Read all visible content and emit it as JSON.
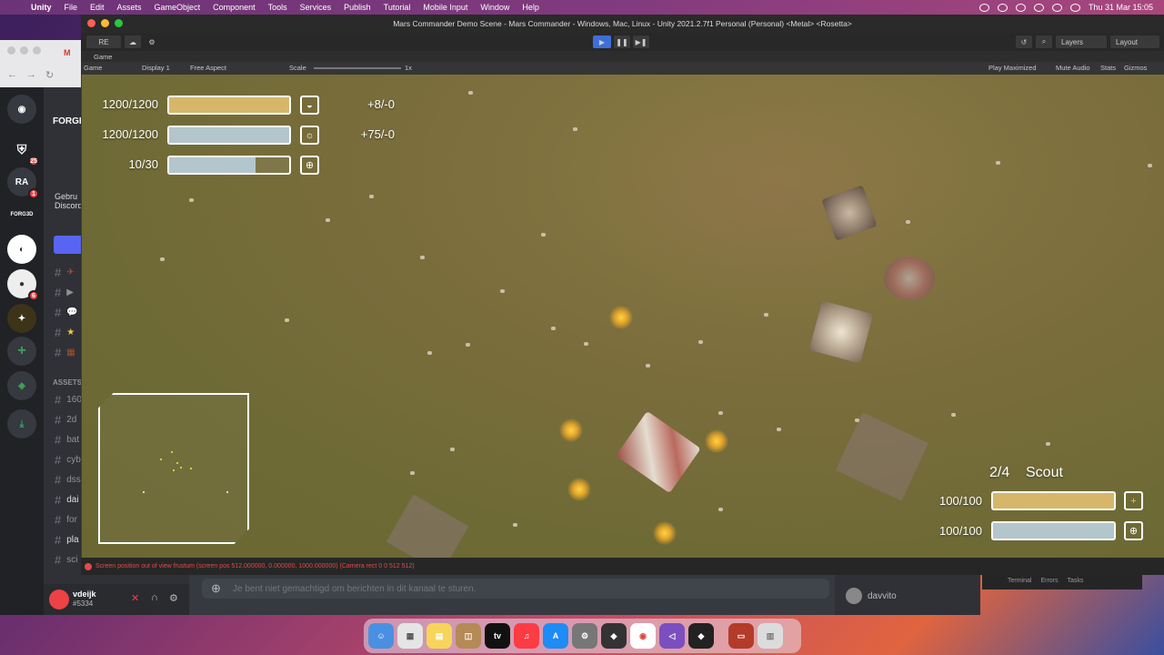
{
  "menubar": {
    "app": "Unity",
    "items": [
      "File",
      "Edit",
      "Assets",
      "GameObject",
      "Component",
      "Tools",
      "Services",
      "Publish",
      "Tutorial",
      "Mobile Input",
      "Window",
      "Help"
    ],
    "clock": "Thu 31 Mar  15:05"
  },
  "discord": {
    "section_header": "ASSETS",
    "channels": [
      "160",
      "2d",
      "bat",
      "cyb",
      "dss",
      "dai",
      "for",
      "pla",
      "sci"
    ],
    "server_badges": {
      "b1": "25",
      "b2": "1",
      "b3": "6"
    },
    "server_label_ra": "RA",
    "server_label_forged": "FORG3D",
    "channel_title": "FORGE",
    "welcome_text": "Gebru Discord",
    "username": "vdeijk",
    "user_tag": "#5334",
    "message_placeholder": "Je bent niet gemachtigd om berichten in dit kanaal te sturen.",
    "member": "davvito"
  },
  "vscode": {
    "terminal": "Terminal",
    "errors": "Errors",
    "tasks": "Tasks"
  },
  "unity": {
    "window_title": "Mars Commander Demo Scene - Mars Commander - Windows, Mac, Linux - Unity 2021.2.7f1 Personal (Personal) <Metal> <Rosetta>",
    "account": "RE",
    "layers": "Layers",
    "layout": "Layout",
    "game_tab": "Game",
    "game_dropdown": "Game",
    "display": "Display 1",
    "aspect": "Free Aspect",
    "scale_label": "Scale",
    "scale_value": "1x",
    "right_options": [
      "Play Maximized",
      "Mute Audio",
      "Stats",
      "Gizmos"
    ],
    "status_message": "Screen position out of view frustum (screen pos 512.000000, 0.000000, 1000.000000) (Camera rect 0 0 512 512)"
  },
  "hud": {
    "resources": [
      {
        "value": "1200/1200",
        "fill": 1.0,
        "color": "#d6b76a",
        "icon": "coin-icon",
        "delta": "+8/-0"
      },
      {
        "value": "1200/1200",
        "fill": 1.0,
        "color": "#b3c6cc",
        "icon": "sun-icon",
        "delta": "+75/-0"
      },
      {
        "value": "10/30",
        "fill": 0.72,
        "color": "#b3c6cc",
        "icon": "crosshair-icon",
        "delta": ""
      }
    ],
    "unit": {
      "count": "2/4",
      "name": "Scout",
      "bars": [
        {
          "value": "100/100",
          "fill": 1.0,
          "color": "#d6b76a",
          "icon": "plus-icon"
        },
        {
          "value": "100/100",
          "fill": 1.0,
          "color": "#b3c6cc",
          "icon": "crosshair-icon"
        }
      ]
    }
  },
  "dock": [
    "Finder",
    "Launchpad",
    "Notes",
    "Archive",
    "TV",
    "Music",
    "App Store",
    "System Preferences",
    "Unity Hub",
    "Chrome",
    "Visual Studio",
    "Unity",
    "Wallet",
    "Trash"
  ]
}
